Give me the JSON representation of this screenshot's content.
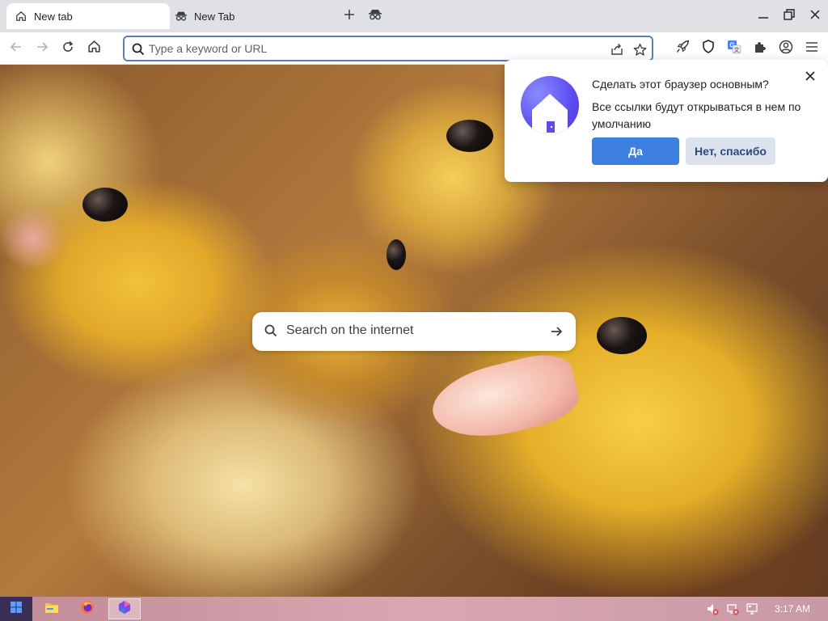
{
  "tabs": [
    {
      "label": "New tab",
      "icon": "home-icon",
      "active": true
    },
    {
      "label": "New Tab",
      "icon": "incognito-icon",
      "active": false
    }
  ],
  "toolbar": {
    "omnibox_placeholder": "Type a keyword or URL"
  },
  "search": {
    "placeholder": "Search on the internet"
  },
  "popup": {
    "title": "Сделать этот браузер основным?",
    "body": "Все ссылки будут открываться в нем по умолчанию",
    "yes_label": "Да",
    "no_label": "Нет, спасибо"
  },
  "taskbar": {
    "clock": "3:17 AM"
  },
  "colors": {
    "accent": "#3d7fe0",
    "omnibox_border": "#5a7fbf",
    "logo": "#5b4cf0",
    "taskbar": "#d9a7b2"
  }
}
